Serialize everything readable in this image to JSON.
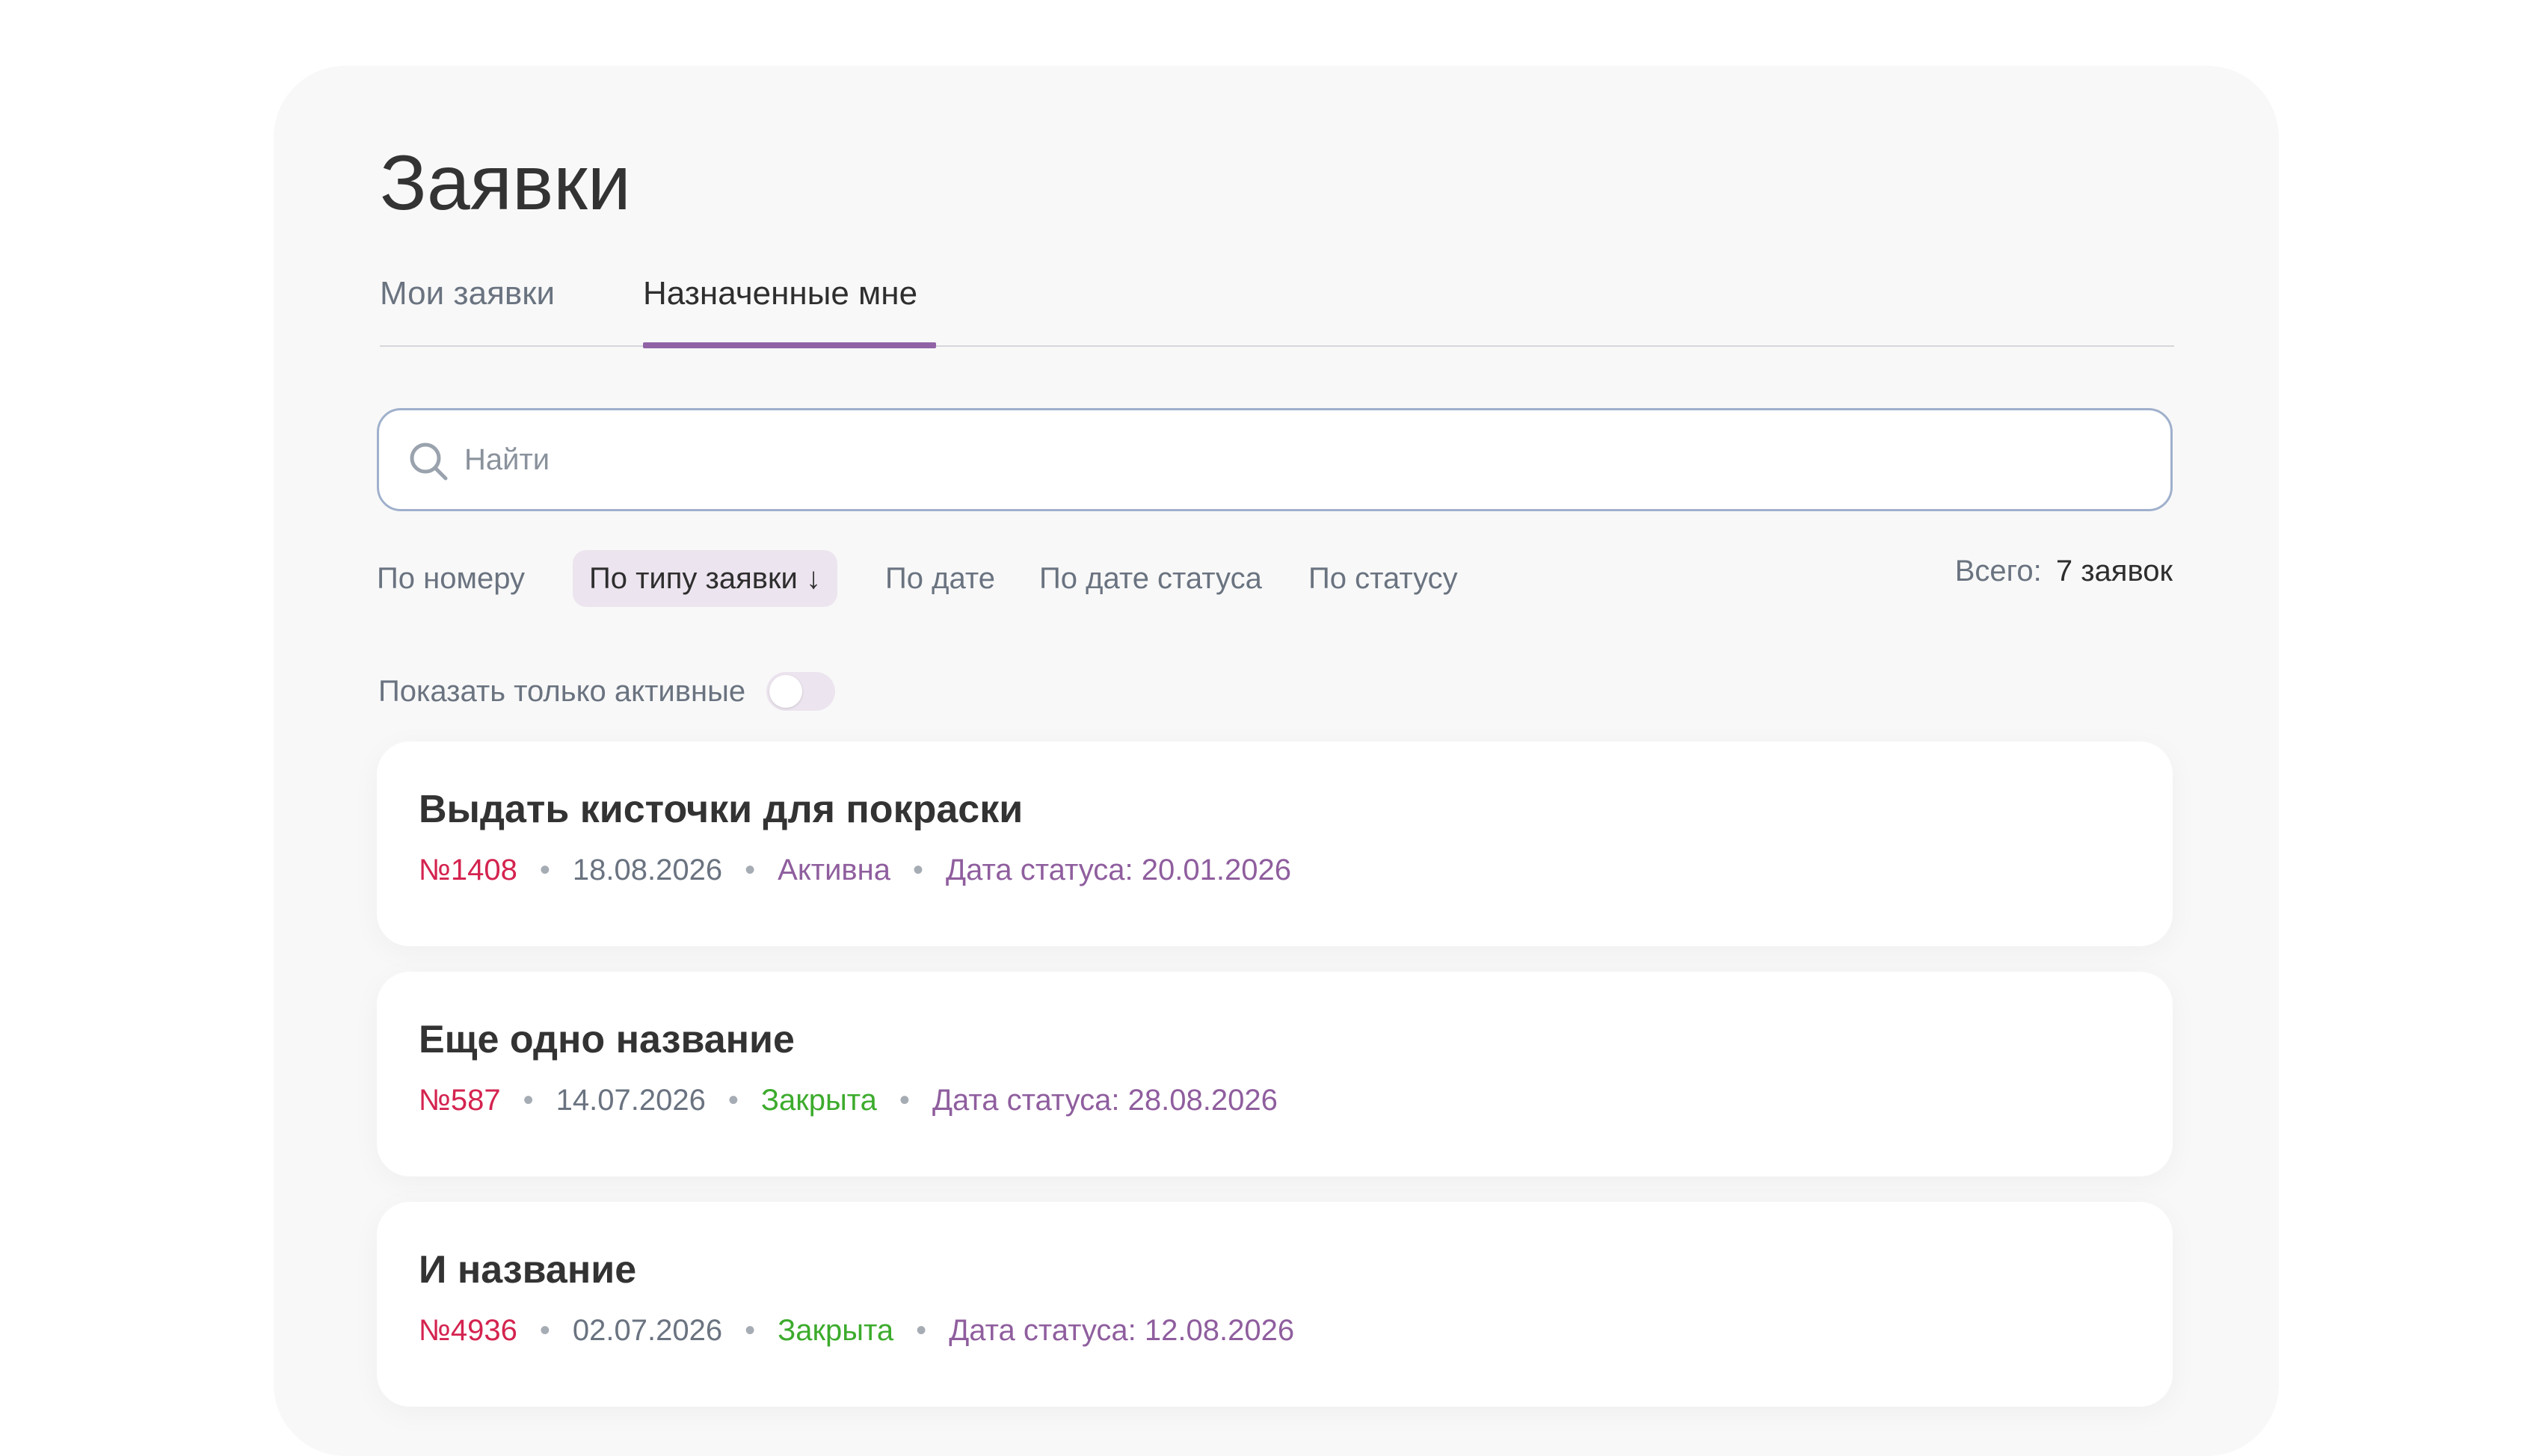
{
  "page": {
    "title": "Заявки"
  },
  "tabs": [
    {
      "label": "Мои заявки",
      "active": false
    },
    {
      "label": "Назначенные мне",
      "active": true
    }
  ],
  "search": {
    "placeholder": "Найти",
    "value": ""
  },
  "sort": {
    "options": [
      {
        "label": "По номеру",
        "active": false
      },
      {
        "label": "По типу заявки ↓",
        "active": true
      },
      {
        "label": "По дате",
        "active": false
      },
      {
        "label": "По дате статуса",
        "active": false
      },
      {
        "label": "По статусу",
        "active": false
      }
    ]
  },
  "total": {
    "label": "Всего:",
    "value": "7 заявок"
  },
  "filter": {
    "active_only_label": "Показать только активные",
    "active_only": false
  },
  "requests": [
    {
      "title": "Выдать кисточки для покраски",
      "number": "№1408",
      "date": "18.08.2026",
      "status": "Активна",
      "status_date": "Дата статуса: 20.01.2026"
    },
    {
      "title": "Еще одно название",
      "number": "№587",
      "date": "14.07.2026",
      "status": "Закрыта",
      "status_date": "Дата статуса: 28.08.2026"
    },
    {
      "title": "И название",
      "number": "№4936",
      "date": "02.07.2026",
      "status": "Закрыта",
      "status_date": "Дата статуса: 12.08.2026"
    }
  ],
  "colors": {
    "accent": "#9163a6",
    "number": "#d4234f",
    "status_active": "#8f5e9e",
    "status_closed": "#3cab2c"
  },
  "icons": {
    "search": "search-icon",
    "sort_direction": "arrow-down-icon"
  }
}
